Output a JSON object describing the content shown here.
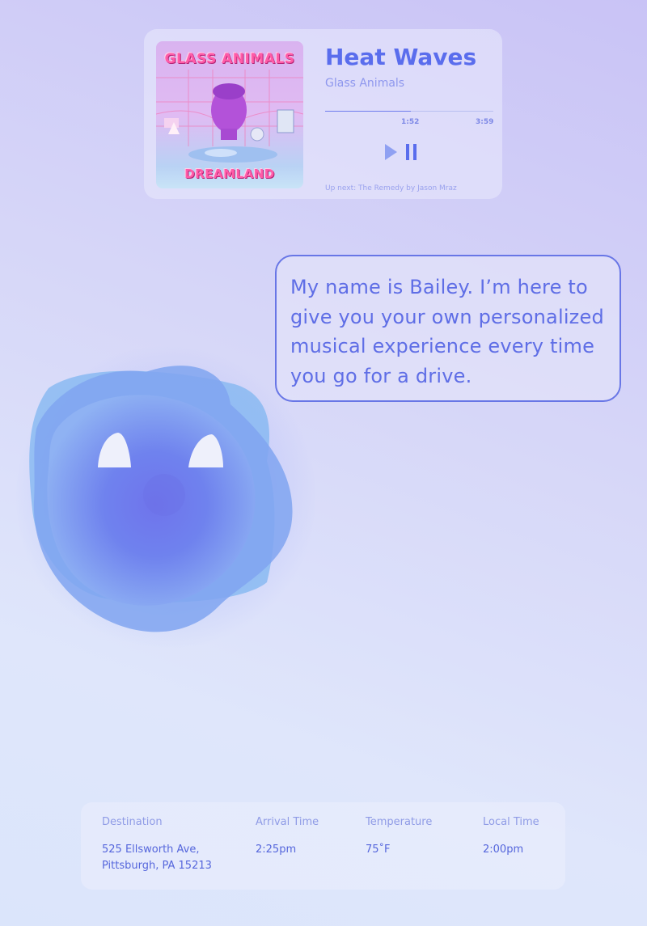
{
  "now_playing": {
    "album_art_top_text": "GLASS ANIMALS",
    "album_art_bottom_text": "DREAMLAND",
    "title": "Heat Waves",
    "artist": "Glass Animals",
    "elapsed": "1:52",
    "duration": "3:59",
    "progress_fraction": 0.51,
    "up_next": "Up next: The Remedy by Jason Mraz",
    "accent_color": "#5a6ded"
  },
  "assistant": {
    "message": "My name is Bailey. I’m here to give you your own personalized musical experience every time you go for a drive.",
    "bubble_border_color": "#6876e6"
  },
  "trip": {
    "destination_label": "Destination",
    "destination_value_line1": "525 Ellsworth Ave,",
    "destination_value_line2": "Pittsburgh, PA 15213",
    "arrival_label": "Arrival Time",
    "arrival_value": "2:25pm",
    "temperature_label": "Temperature",
    "temperature_value": "75˚F",
    "local_time_label": "Local Time",
    "local_time_value": "2:00pm"
  }
}
